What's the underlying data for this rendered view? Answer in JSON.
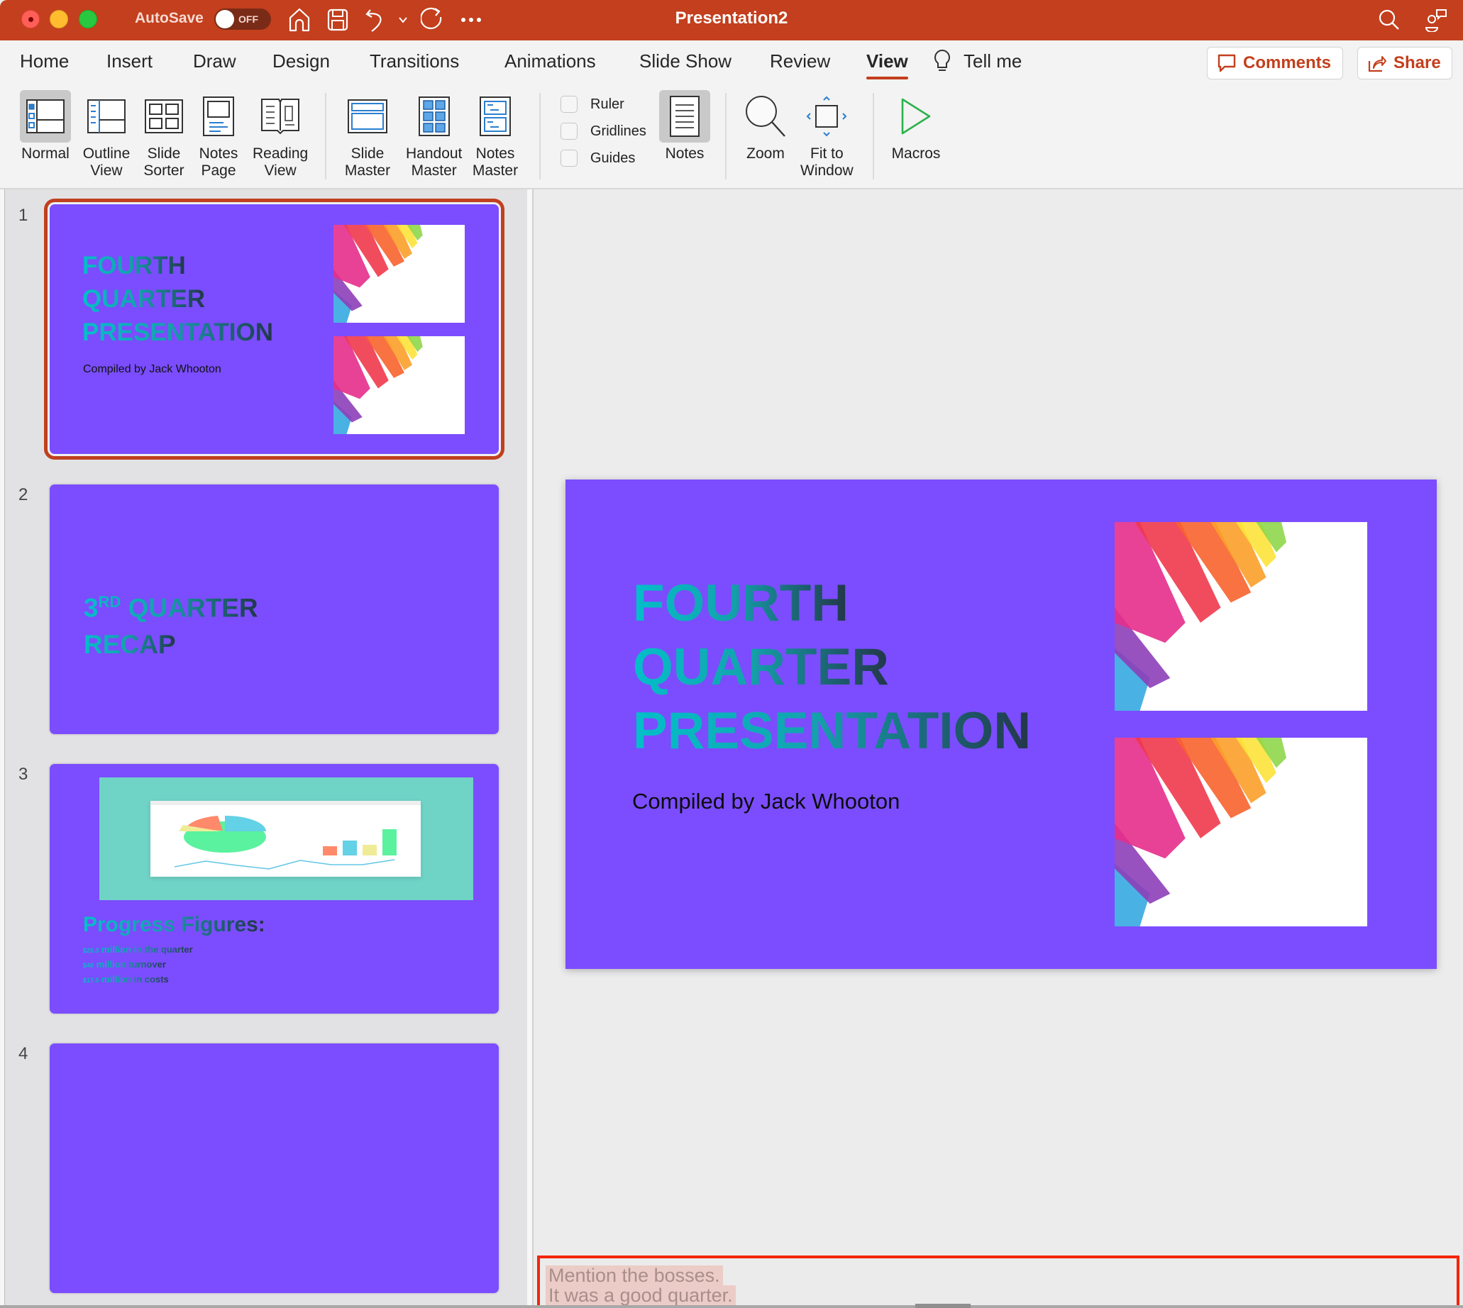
{
  "window": {
    "title": "Presentation2",
    "autosave_label": "AutoSave",
    "autosave_state": "OFF"
  },
  "title_icons": [
    "home-icon",
    "save-icon",
    "undo-icon",
    "undo-dropdown-icon",
    "redo-icon",
    "more-icon",
    "search-icon",
    "collaborate-icon"
  ],
  "tabs": [
    {
      "label": "Home"
    },
    {
      "label": "Insert"
    },
    {
      "label": "Draw"
    },
    {
      "label": "Design"
    },
    {
      "label": "Transitions"
    },
    {
      "label": "Animations"
    },
    {
      "label": "Slide Show"
    },
    {
      "label": "Review"
    },
    {
      "label": "View",
      "active": true
    },
    {
      "label": "Tell me"
    }
  ],
  "header_buttons": {
    "comments": "Comments",
    "share": "Share"
  },
  "ribbon": {
    "presentation_views": [
      {
        "line1": "Normal",
        "line2": "",
        "selected": true
      },
      {
        "line1": "Outline",
        "line2": "View"
      },
      {
        "line1": "Slide",
        "line2": "Sorter"
      },
      {
        "line1": "Notes",
        "line2": "Page"
      },
      {
        "line1": "Reading",
        "line2": "View"
      }
    ],
    "master_views": [
      {
        "line1": "Slide",
        "line2": "Master"
      },
      {
        "line1": "Handout",
        "line2": "Master"
      },
      {
        "line1": "Notes",
        "line2": "Master"
      }
    ],
    "show": [
      {
        "label": "Ruler",
        "checked": false
      },
      {
        "label": "Gridlines",
        "checked": false
      },
      {
        "label": "Guides",
        "checked": false
      }
    ],
    "notes": {
      "label": "Notes",
      "selected": true
    },
    "zoom": {
      "label": "Zoom"
    },
    "fit": {
      "line1": "Fit to",
      "line2": "Window"
    },
    "macros": {
      "label": "Macros"
    }
  },
  "slides": [
    {
      "number": "1",
      "title_lines": [
        "FOURTH",
        "QUARTER",
        "PRESENTATION"
      ],
      "subtitle": "Compiled by Jack Whooton",
      "selected": true
    },
    {
      "number": "2",
      "title_sup_prefix": "3",
      "title_sup": "RD",
      "title_line1_rest": " QUARTER",
      "title_line2": "RECAP"
    },
    {
      "number": "3",
      "heading": "Progress Figures",
      "heading_suffix": ":",
      "bullets": [
        {
          "amount": "$20.3",
          "text": " million in the quarter"
        },
        {
          "amount": "$40",
          "text": " million turnover"
        },
        {
          "amount": "$17.5",
          "text": " million in costs"
        }
      ]
    },
    {
      "number": "4"
    }
  ],
  "main_slide": {
    "title_lines": [
      "FOURTH",
      "QUARTER",
      "PRESENTATION"
    ],
    "subtitle": "Compiled by Jack Whooton"
  },
  "notes": {
    "lines": [
      "Mention the bosses.",
      "It was a good quarter."
    ]
  },
  "colors": {
    "accent": "#c33f1d",
    "slide_background": "#7b4dff",
    "title_gradient_start": "#03bfc9",
    "title_gradient_end": "#233649",
    "notes_highlight_border": "#f4250a",
    "macro_green": "#2bb24c"
  }
}
